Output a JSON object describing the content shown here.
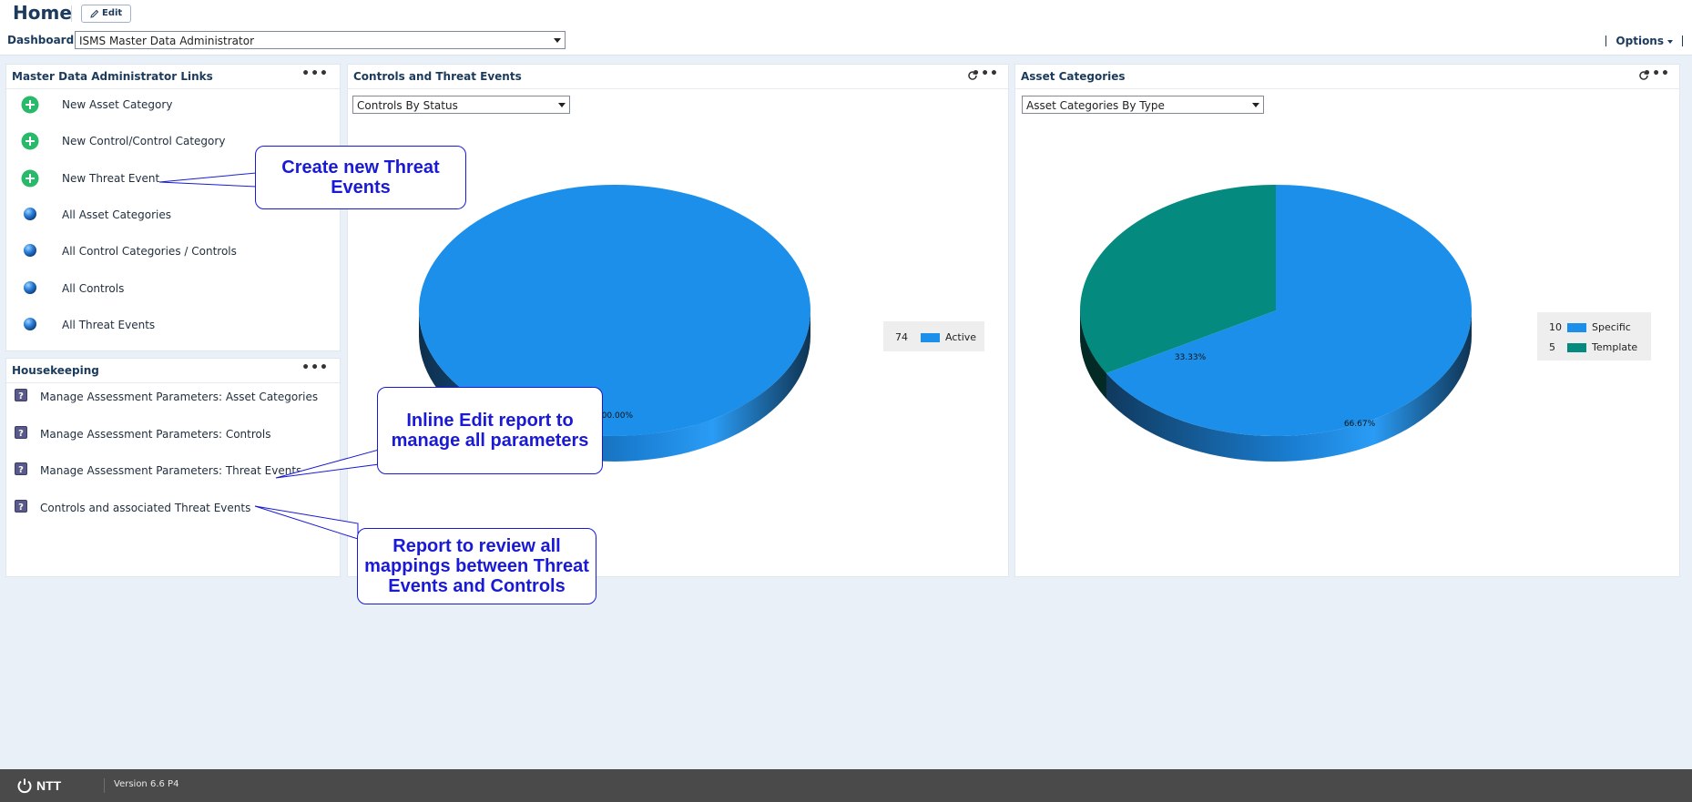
{
  "header": {
    "title": "Home",
    "edit_label": "Edit",
    "dashboard_label": "Dashboard:",
    "dashboard_value": "ISMS Master Data Administrator",
    "options_label": "Options"
  },
  "links_panel": {
    "title": "Master Data Administrator Links",
    "items": [
      {
        "label": "New Asset Category",
        "icon": "add-icon"
      },
      {
        "label": "New Control/Control Category",
        "icon": "add-icon"
      },
      {
        "label": "New Threat Event",
        "icon": "add-icon"
      },
      {
        "label": "All Asset Categories",
        "icon": "globe-icon"
      },
      {
        "label": "All Control Categories / Controls",
        "icon": "globe-icon"
      },
      {
        "label": "All Controls",
        "icon": "globe-icon"
      },
      {
        "label": "All Threat Events",
        "icon": "globe-icon"
      }
    ]
  },
  "housekeeping_panel": {
    "title": "Housekeeping",
    "items": [
      {
        "label": "Manage Assessment Parameters: Asset Categories",
        "icon": "report-icon"
      },
      {
        "label": "Manage Assessment Parameters: Controls",
        "icon": "report-icon"
      },
      {
        "label": "Manage Assessment Parameters: Threat Events",
        "icon": "report-icon"
      },
      {
        "label": "Controls and associated Threat Events",
        "icon": "report-icon"
      }
    ]
  },
  "controls_panel": {
    "title": "Controls and Threat Events",
    "select_value": "Controls By Status",
    "pie_label": "100.00%"
  },
  "assets_panel": {
    "title": "Asset Categories",
    "select_value": "Asset Categories By Type",
    "label_template": "33.33%",
    "label_specific": "66.67%"
  },
  "callouts": {
    "threat": "Create new Threat Events",
    "inline": "Inline Edit report to manage all parameters",
    "review": "Report to review all mappings between Threat Events and Controls"
  },
  "footer": {
    "brand": "NTT",
    "version": "Version 6.6 P4"
  },
  "chart_data": [
    {
      "type": "pie",
      "title": "Controls and Threat Events",
      "categories": [
        "Active"
      ],
      "values": [
        74
      ],
      "percent_labels": [
        "100.00%"
      ],
      "colors": [
        "#1b8fe9"
      ],
      "legend": "right"
    },
    {
      "type": "pie",
      "title": "Asset Categories",
      "categories": [
        "Specific",
        "Template"
      ],
      "values": [
        10,
        5
      ],
      "percent_labels": [
        "66.67%",
        "33.33%"
      ],
      "colors": [
        "#1b8fe9",
        "#058a80"
      ],
      "legend": "right"
    }
  ],
  "colors": {
    "accent": "#1b3a5c",
    "callout": "#1a1ad6",
    "add_icon": "#29b96a",
    "series_blue": "#1b8fe9",
    "series_teal": "#058a80"
  }
}
